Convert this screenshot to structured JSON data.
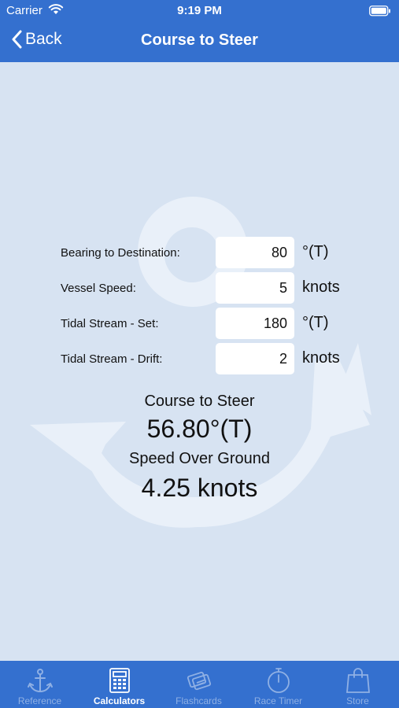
{
  "status_bar": {
    "carrier": "Carrier",
    "time": "9:19 PM"
  },
  "nav": {
    "back_label": "Back",
    "title": "Course to Steer"
  },
  "form": {
    "rows": [
      {
        "label": "Bearing to Destination:",
        "value": "80",
        "unit": "°(T)"
      },
      {
        "label": "Vessel Speed:",
        "value": "5",
        "unit": "knots"
      },
      {
        "label": "Tidal Stream - Set:",
        "value": "180",
        "unit": "°(T)"
      },
      {
        "label": "Tidal Stream - Drift:",
        "value": "2",
        "unit": "knots"
      }
    ]
  },
  "results": {
    "course_label": "Course to Steer",
    "course_value": "56.80°(T)",
    "speed_label": "Speed Over Ground",
    "speed_value": "4.25 knots"
  },
  "tabs": [
    {
      "label": "Reference",
      "icon": "anchor-icon"
    },
    {
      "label": "Calculators",
      "icon": "calculator-icon",
      "active": true
    },
    {
      "label": "Flashcards",
      "icon": "flashcards-icon"
    },
    {
      "label": "Race Timer",
      "icon": "stopwatch-icon"
    },
    {
      "label": "Store",
      "icon": "shopping-bag-icon"
    }
  ],
  "colors": {
    "primary": "#3470cf",
    "background": "#d7e3f2",
    "watermark": "#e9f0f9",
    "tab_inactive": "#8fb0e4"
  }
}
